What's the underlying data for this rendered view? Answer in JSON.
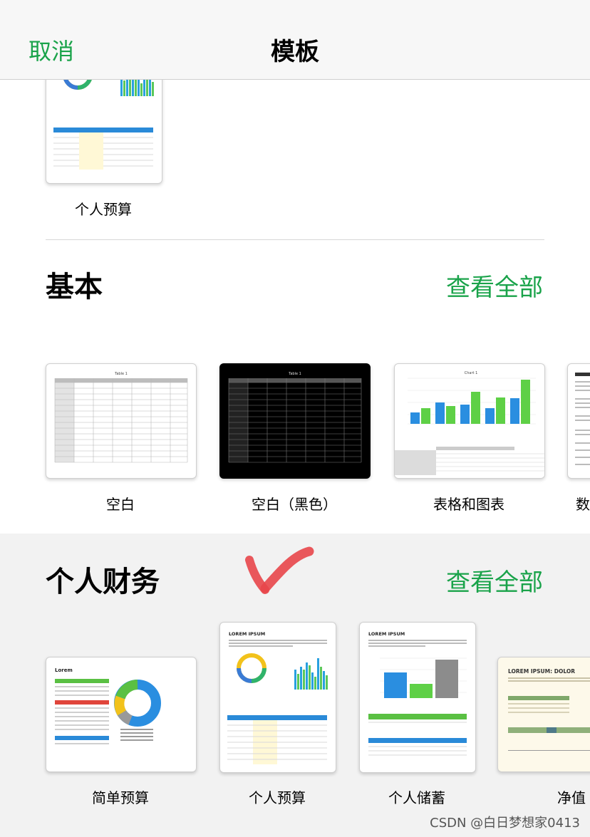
{
  "header": {
    "cancel_label": "取消",
    "title": "模板"
  },
  "top_template": {
    "label": "个人预算"
  },
  "basic": {
    "title": "基本",
    "see_all": "查看全部",
    "templates": [
      {
        "label": "空白",
        "preview_title": "Table 1"
      },
      {
        "label": "空白（黑色）",
        "preview_title": "Table 1"
      },
      {
        "label": "表格和图表",
        "preview_title": "Chart 1"
      },
      {
        "label": "数"
      }
    ]
  },
  "personal_finance": {
    "title": "个人财务",
    "see_all": "查看全部",
    "templates": [
      {
        "label": "简单预算",
        "preview_title": "Lorem"
      },
      {
        "label": "个人预算",
        "preview_title": "LOREM IPSUM"
      },
      {
        "label": "个人储蓄",
        "preview_title": "LOREM IPSUM"
      },
      {
        "label": "净值",
        "preview_title": "LOREM IPSUM: DOLOR"
      }
    ]
  },
  "watermark": "CSDN @白日梦想家0413",
  "colors": {
    "accent": "#1aa34a",
    "arrow": "#e8464a"
  }
}
